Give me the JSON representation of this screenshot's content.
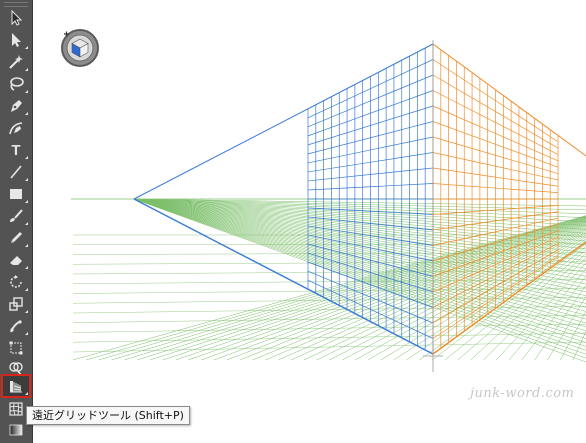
{
  "tooltip": {
    "text": "遠近グリッドツール (Shift+P)"
  },
  "watermark": {
    "text": "junk-word.com"
  },
  "tools": [
    {
      "name": "selection-tool",
      "icon": "selection-arrow-icon"
    },
    {
      "name": "direct-selection-tool",
      "icon": "direct-selection-icon"
    },
    {
      "name": "magic-wand-tool",
      "icon": "magic-wand-icon"
    },
    {
      "name": "lasso-tool",
      "icon": "lasso-icon"
    },
    {
      "name": "pen-tool",
      "icon": "pen-icon"
    },
    {
      "name": "curvature-tool",
      "icon": "curvature-pen-icon"
    },
    {
      "name": "type-tool",
      "icon": "type-icon",
      "label": "T"
    },
    {
      "name": "line-segment-tool",
      "icon": "line-icon"
    },
    {
      "name": "rectangle-tool",
      "icon": "rectangle-icon"
    },
    {
      "name": "paintbrush-tool",
      "icon": "paintbrush-icon"
    },
    {
      "name": "pencil-tool",
      "icon": "pencil-icon"
    },
    {
      "name": "eraser-tool",
      "icon": "eraser-icon"
    },
    {
      "name": "rotate-tool",
      "icon": "rotate-icon"
    },
    {
      "name": "scale-tool",
      "icon": "scale-icon"
    },
    {
      "name": "puppet-warp-tool",
      "icon": "puppet-warp-icon"
    },
    {
      "name": "free-transform-tool",
      "icon": "free-transform-icon"
    },
    {
      "name": "shape-builder-tool",
      "icon": "shape-builder-icon"
    },
    {
      "name": "perspective-grid-tool",
      "icon": "perspective-grid-icon",
      "active": true
    },
    {
      "name": "mesh-tool",
      "icon": "mesh-icon"
    },
    {
      "name": "gradient-tool",
      "icon": "gradient-icon"
    }
  ],
  "colors": {
    "toolbar": "#535353",
    "left_grid": "#3a7bd5",
    "right_grid": "#f28c28",
    "ground_grid": "#7cbf6a",
    "horizon": "#7cbf6a",
    "active_highlight": "#d9261c"
  }
}
